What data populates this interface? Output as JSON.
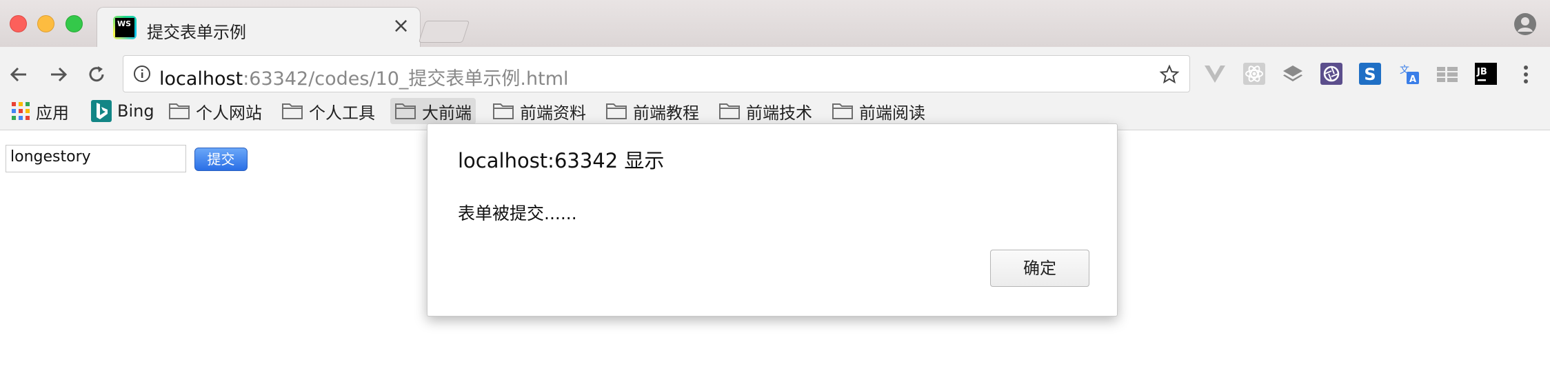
{
  "tab": {
    "favicon_text": "WS",
    "title": "提交表单示例",
    "close_glyph": "×"
  },
  "omnibox": {
    "url_host": "localhost",
    "url_rest": ":63342/codes/10_提交表单示例.html"
  },
  "extensions": [
    "vue-devtools-icon",
    "react-devtools-icon",
    "layers-icon",
    "aperture-icon",
    "s-extension-icon",
    "translate-icon",
    "grid-icon",
    "jetbrains-icon"
  ],
  "bookmarks": [
    {
      "label": "应用",
      "icon": "apps-grid-icon"
    },
    {
      "label": "Bing",
      "icon": "bing-icon"
    },
    {
      "label": "个人网站",
      "icon": "folder-icon"
    },
    {
      "label": "个人工具",
      "icon": "folder-icon"
    },
    {
      "label": "大前端",
      "icon": "folder-icon"
    },
    {
      "label": "前端资料",
      "icon": "folder-icon"
    },
    {
      "label": "前端教程",
      "icon": "folder-icon"
    },
    {
      "label": "前端技术",
      "icon": "folder-icon"
    },
    {
      "label": "前端阅读",
      "icon": "folder-icon"
    }
  ],
  "page": {
    "input_value": "longestory",
    "submit_label": "提交"
  },
  "dialog": {
    "title": "localhost:63342 显示",
    "message": "表单被提交......",
    "ok_label": "确定"
  },
  "colors": {
    "accent": "#2a6fe6",
    "close": "#fc605b",
    "minimize": "#fdbc40",
    "maximize": "#34c84a"
  }
}
